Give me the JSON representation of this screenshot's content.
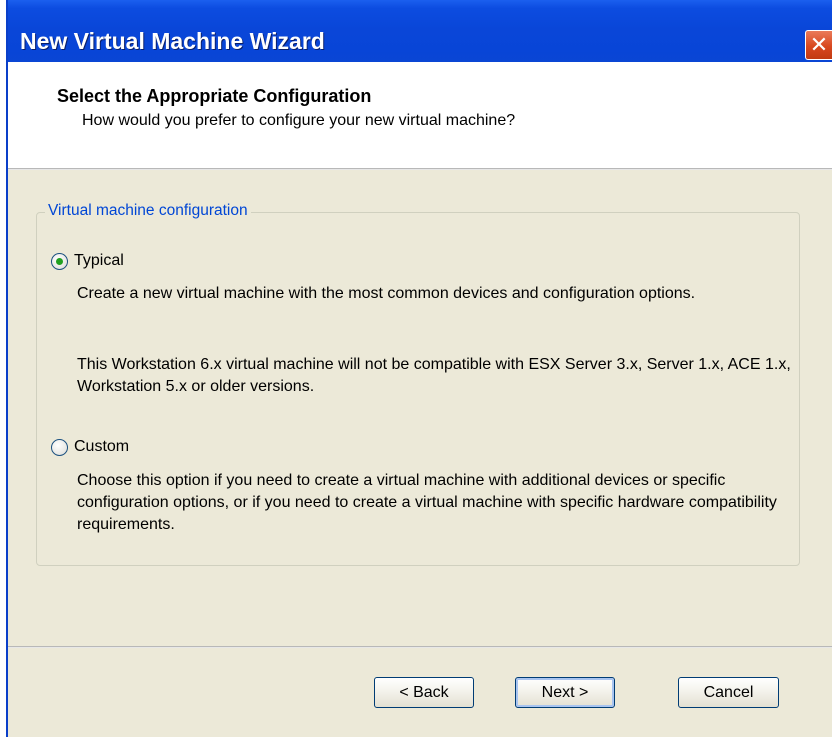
{
  "window": {
    "title": "New Virtual Machine Wizard",
    "close_symbol": "✕"
  },
  "header": {
    "title": "Select the Appropriate Configuration",
    "subtitle": "How would you prefer to configure your new virtual machine?"
  },
  "config": {
    "group_label": "Virtual machine configuration",
    "options": [
      {
        "label": "Typical",
        "checked": true,
        "description_1": "Create a new virtual machine with the most common devices and configuration options.",
        "description_2": "This Workstation 6.x virtual machine will not be compatible with ESX Server 3.x, Server 1.x, ACE 1.x, Workstation 5.x or older versions."
      },
      {
        "label": "Custom",
        "checked": false,
        "description_1": "Choose this option if you need to create a virtual machine with additional devices or specific configuration options, or if you need to create a virtual machine with specific hardware compatibility requirements."
      }
    ]
  },
  "buttons": {
    "back": "< Back",
    "next": "Next >",
    "cancel": "Cancel"
  },
  "colors": {
    "titlebar": "#0845D7",
    "dialog_background": "#ECE9D8",
    "group_label": "#0046D5",
    "radio_selected": "#21A121",
    "close_button": "#D8481F"
  }
}
